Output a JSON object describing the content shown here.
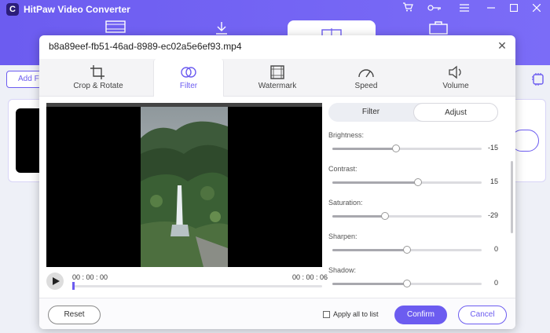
{
  "app": {
    "title": "HitPaw Video Converter",
    "logo_letter": "C"
  },
  "window_controls": [
    {
      "name": "cart-icon",
      "glyph": "🛒"
    },
    {
      "name": "key-icon",
      "glyph": "⚿"
    },
    {
      "name": "menu-icon",
      "glyph": "☰"
    },
    {
      "name": "minimize-icon",
      "glyph": "—"
    },
    {
      "name": "maximize-icon",
      "glyph": "☐"
    },
    {
      "name": "close-icon",
      "glyph": "✕"
    }
  ],
  "background": {
    "add_label": "Add F"
  },
  "dialog": {
    "title": "b8a89eef-fb51-46ad-8989-ec02a5e6ef93.mp4",
    "close_glyph": "✕",
    "tabs": [
      {
        "label": "Crop & Rotate",
        "icon": "crop-icon",
        "active": false
      },
      {
        "label": "Filter",
        "icon": "filter-icon",
        "active": true
      },
      {
        "label": "Watermark",
        "icon": "watermark-icon",
        "active": false
      },
      {
        "label": "Speed",
        "icon": "speedometer-icon",
        "active": false
      },
      {
        "label": "Volume",
        "icon": "volume-icon",
        "active": false
      }
    ],
    "player": {
      "current_time": "00 : 00 : 00",
      "total_time": "00 : 00 : 06",
      "progress": 0
    },
    "segment": {
      "filter_label": "Filter",
      "adjust_label": "Adjust",
      "selected": "Adjust"
    },
    "adjustments": [
      {
        "label": "Brightness:",
        "value": -15,
        "display": "-15"
      },
      {
        "label": "Contrast:",
        "value": 15,
        "display": "15"
      },
      {
        "label": "Saturation:",
        "value": -29,
        "display": "-29"
      },
      {
        "label": "Sharpen:",
        "value": 0,
        "display": "0"
      },
      {
        "label": "Shadow:",
        "value": 0,
        "display": "0"
      }
    ],
    "footer": {
      "reset_label": "Reset",
      "apply_all_label": "Apply all to list",
      "apply_all_checked": false,
      "confirm_label": "Confirm",
      "cancel_label": "Cancel"
    }
  },
  "colors": {
    "accent": "#6c5cf0",
    "topbar": "#7b6cf7"
  }
}
